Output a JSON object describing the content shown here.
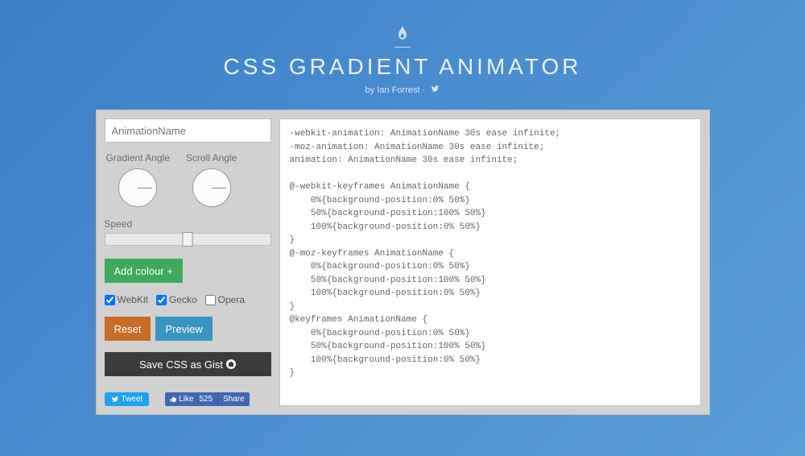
{
  "header": {
    "title": "CSS GRADIENT ANIMATOR",
    "byline_prefix": "by ",
    "author": "Ian Forrest",
    "separator": " · "
  },
  "controls": {
    "name_placeholder": "AnimationName",
    "gradient_angle_label": "Gradient Angle",
    "scroll_angle_label": "Scroll Angle",
    "speed_label": "Speed",
    "add_colour_label": "Add colour +",
    "checkboxes": {
      "webkit": {
        "label": "WebKit",
        "checked": true
      },
      "gecko": {
        "label": "Gecko",
        "checked": true
      },
      "opera": {
        "label": "Opera",
        "checked": false
      }
    },
    "reset_label": "Reset",
    "preview_label": "Preview",
    "gist_label": "Save CSS as Gist"
  },
  "social": {
    "tweet": "Tweet",
    "like": "Like",
    "like_count": "525",
    "share": "Share"
  },
  "code": "-webkit-animation: AnimationName 30s ease infinite;\n-moz-animation: AnimationName 30s ease infinite;\nanimation: AnimationName 30s ease infinite;\n\n@-webkit-keyframes AnimationName {\n    0%{background-position:0% 50%}\n    50%{background-position:100% 50%}\n    100%{background-position:0% 50%}\n}\n@-moz-keyframes AnimationName {\n    0%{background-position:0% 50%}\n    50%{background-position:100% 50%}\n    100%{background-position:0% 50%}\n}\n@keyframes AnimationName {\n    0%{background-position:0% 50%}\n    50%{background-position:100% 50%}\n    100%{background-position:0% 50%}\n}"
}
